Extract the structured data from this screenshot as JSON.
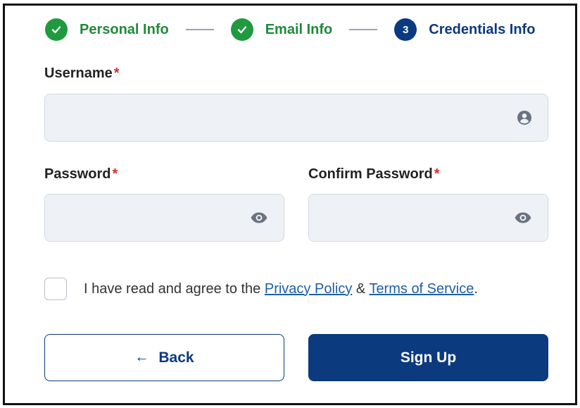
{
  "stepper": {
    "steps": [
      {
        "label": "Personal Info",
        "state": "done"
      },
      {
        "label": "Email Info",
        "state": "done"
      },
      {
        "label": "Credentials Info",
        "state": "current",
        "number": "3"
      }
    ]
  },
  "form": {
    "username": {
      "label": "Username",
      "required_mark": "*",
      "value": "",
      "icon": "user-circle-icon"
    },
    "password": {
      "label": "Password",
      "required_mark": "*",
      "value": "",
      "icon": "eye-icon"
    },
    "confirm_password": {
      "label": "Confirm Password",
      "required_mark": "*",
      "value": "",
      "icon": "eye-icon"
    },
    "agreement": {
      "checked": false,
      "prefix": "I have read and agree to the ",
      "privacy_link": "Privacy Policy",
      "joiner": " & ",
      "terms_link": "Terms of Service",
      "suffix": "."
    }
  },
  "buttons": {
    "back": "Back",
    "back_icon": "arrow-left-icon",
    "signup": "Sign Up"
  },
  "colors": {
    "primary": "#0b3a7e",
    "success": "#1f9a3e",
    "required": "#d32f2f",
    "link": "#1d5fa5"
  }
}
